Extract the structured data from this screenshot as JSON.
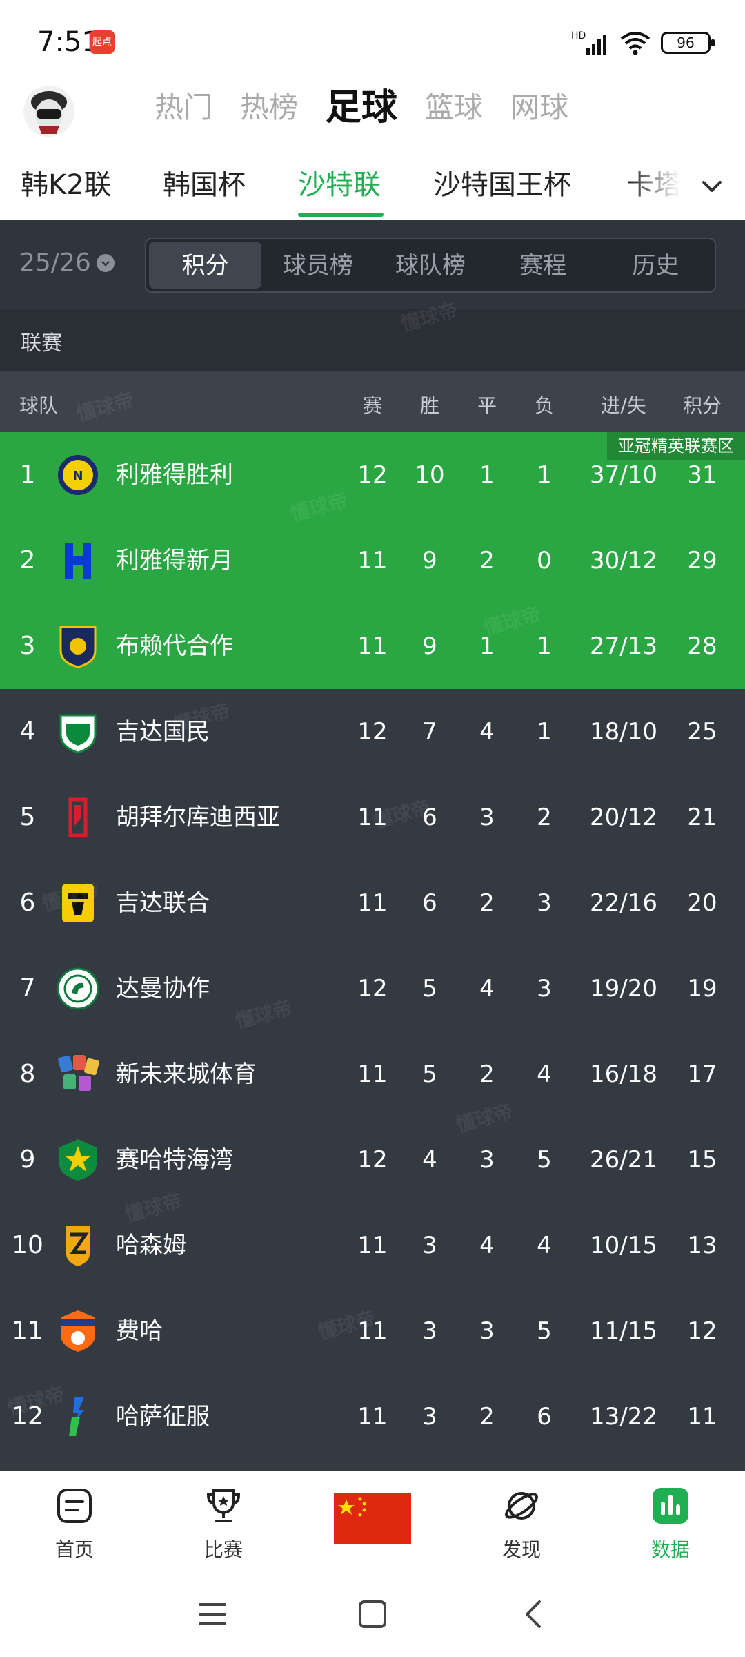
{
  "status_bar": {
    "time": "7:51",
    "badge": "起点",
    "signal_label": "HD",
    "battery": "96"
  },
  "top_tabs": [
    "热门",
    "热榜",
    "足球",
    "篮球",
    "网球"
  ],
  "active_top_tab": "足球",
  "league_tabs": [
    "韩K2联",
    "韩国杯",
    "沙特联",
    "沙特国王杯",
    "卡塔"
  ],
  "active_league_tab": "沙特联",
  "season": "25/26",
  "segments": [
    "积分",
    "球员榜",
    "球队榜",
    "赛程",
    "历史"
  ],
  "section_title": "联赛",
  "table": {
    "headers": {
      "team": "球队",
      "played": "赛",
      "won": "胜",
      "drawn": "平",
      "lost": "负",
      "goals": "进/失",
      "points": "积分"
    },
    "zone_label": "亚冠精英联赛区",
    "rows": [
      {
        "rank": "1",
        "team": "利雅得胜利",
        "played": "12",
        "won": "10",
        "drawn": "1",
        "lost": "1",
        "goals": "37/10",
        "points": "31",
        "logo": "al-nassr-icon"
      },
      {
        "rank": "2",
        "team": "利雅得新月",
        "played": "11",
        "won": "9",
        "drawn": "2",
        "lost": "0",
        "goals": "30/12",
        "points": "29",
        "logo": "al-hilal-icon"
      },
      {
        "rank": "3",
        "team": "布赖代合作",
        "played": "11",
        "won": "9",
        "drawn": "1",
        "lost": "1",
        "goals": "27/13",
        "points": "28",
        "logo": "al-taawoun-icon"
      },
      {
        "rank": "4",
        "team": "吉达国民",
        "played": "12",
        "won": "7",
        "drawn": "4",
        "lost": "1",
        "goals": "18/10",
        "points": "25",
        "logo": "al-ahli-icon"
      },
      {
        "rank": "5",
        "team": "胡拜尔库迪西亚",
        "played": "11",
        "won": "6",
        "drawn": "3",
        "lost": "2",
        "goals": "20/12",
        "points": "21",
        "logo": "al-qadsiah-icon"
      },
      {
        "rank": "6",
        "team": "吉达联合",
        "played": "11",
        "won": "6",
        "drawn": "2",
        "lost": "3",
        "goals": "22/16",
        "points": "20",
        "logo": "al-ittihad-icon"
      },
      {
        "rank": "7",
        "team": "达曼协作",
        "played": "12",
        "won": "5",
        "drawn": "4",
        "lost": "3",
        "goals": "19/20",
        "points": "19",
        "logo": "al-ettifaq-icon"
      },
      {
        "rank": "8",
        "team": "新未来城体育",
        "played": "11",
        "won": "5",
        "drawn": "2",
        "lost": "4",
        "goals": "16/18",
        "points": "17",
        "logo": "neom-icon"
      },
      {
        "rank": "9",
        "team": "赛哈特海湾",
        "played": "12",
        "won": "4",
        "drawn": "3",
        "lost": "5",
        "goals": "26/21",
        "points": "15",
        "logo": "al-khaleej-icon"
      },
      {
        "rank": "10",
        "team": "哈森姆",
        "played": "11",
        "won": "3",
        "drawn": "4",
        "lost": "4",
        "goals": "10/15",
        "points": "13",
        "logo": "al-hazem-icon"
      },
      {
        "rank": "11",
        "team": "费哈",
        "played": "11",
        "won": "3",
        "drawn": "3",
        "lost": "5",
        "goals": "11/15",
        "points": "12",
        "logo": "al-fayha-icon"
      },
      {
        "rank": "12",
        "team": "哈萨征服",
        "played": "11",
        "won": "3",
        "drawn": "2",
        "lost": "6",
        "goals": "13/22",
        "points": "11",
        "logo": "al-fateh-icon"
      }
    ]
  },
  "watermark_text": "懂球帝",
  "bottom_nav": [
    {
      "label": "首页",
      "icon": "home-icon"
    },
    {
      "label": "比赛",
      "icon": "trophy-icon"
    },
    {
      "label": "",
      "icon": "china-flag-icon"
    },
    {
      "label": "发现",
      "icon": "planet-icon"
    },
    {
      "label": "数据",
      "icon": "data-chart-icon"
    }
  ],
  "active_bottom_nav": "数据",
  "colors": {
    "accent": "#1fae52",
    "zone_green": "#2aa742",
    "panel": "#333a42"
  }
}
